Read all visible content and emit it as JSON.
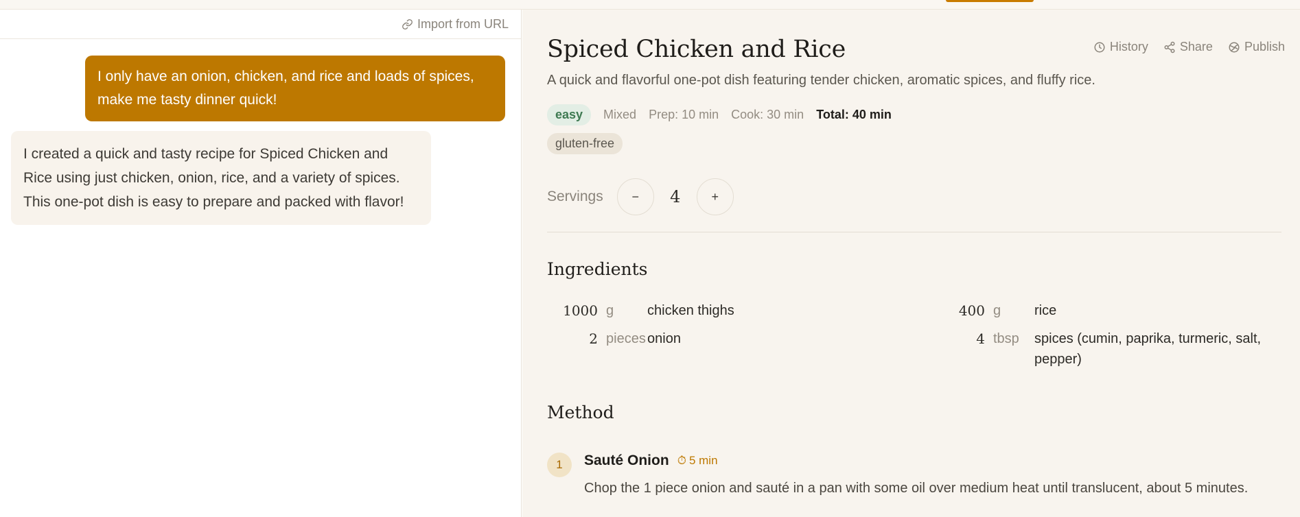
{
  "chat": {
    "import_label": "Import from URL",
    "user_message": "I only have an onion, chicken, and rice and loads of spices, make me tasty dinner quick!",
    "assistant_message": "I created a quick and tasty recipe for Spiced Chicken and Rice using just chicken, onion, rice, and a variety of spices. This one-pot dish is easy to prepare and packed with flavor!"
  },
  "recipe": {
    "title": "Spiced Chicken and Rice",
    "actions": {
      "history": "History",
      "share": "Share",
      "publish": "Publish"
    },
    "description": "A quick and flavorful one-pot dish featuring tender chicken, aromatic spices, and fluffy rice.",
    "meta": {
      "difficulty": "easy",
      "cuisine": "Mixed",
      "prep": "Prep: 10 min",
      "cook": "Cook: 30 min",
      "total": "Total: 40 min"
    },
    "tags": [
      "gluten-free"
    ],
    "servings": {
      "label": "Servings",
      "minus": "−",
      "plus": "+",
      "count": "4"
    },
    "ingredients_heading": "Ingredients",
    "ingredients": [
      {
        "qty": "1000",
        "unit": "g",
        "name": "chicken thighs"
      },
      {
        "qty": "2",
        "unit": "pieces",
        "name": "onion"
      },
      {
        "qty": "400",
        "unit": "g",
        "name": "rice"
      },
      {
        "qty": "4",
        "unit": "tbsp",
        "name": "spices (cumin, paprika, turmeric, salt, pepper)"
      }
    ],
    "method_heading": "Method",
    "steps": [
      {
        "number": "1",
        "title": "Sauté Onion",
        "time": "5 min",
        "text": "Chop the 1 piece onion and sauté in a pan with some oil over medium heat until translucent, about 5 minutes."
      }
    ]
  },
  "colors": {
    "accent": "#bd7800",
    "easy_badge_bg": "#e3eee5",
    "easy_badge_text": "#3f7a52",
    "recipe_bg": "#f8f4ee"
  },
  "icons": [
    "link-icon",
    "clock-icon",
    "share-icon",
    "globe-icon",
    "timer-icon"
  ]
}
